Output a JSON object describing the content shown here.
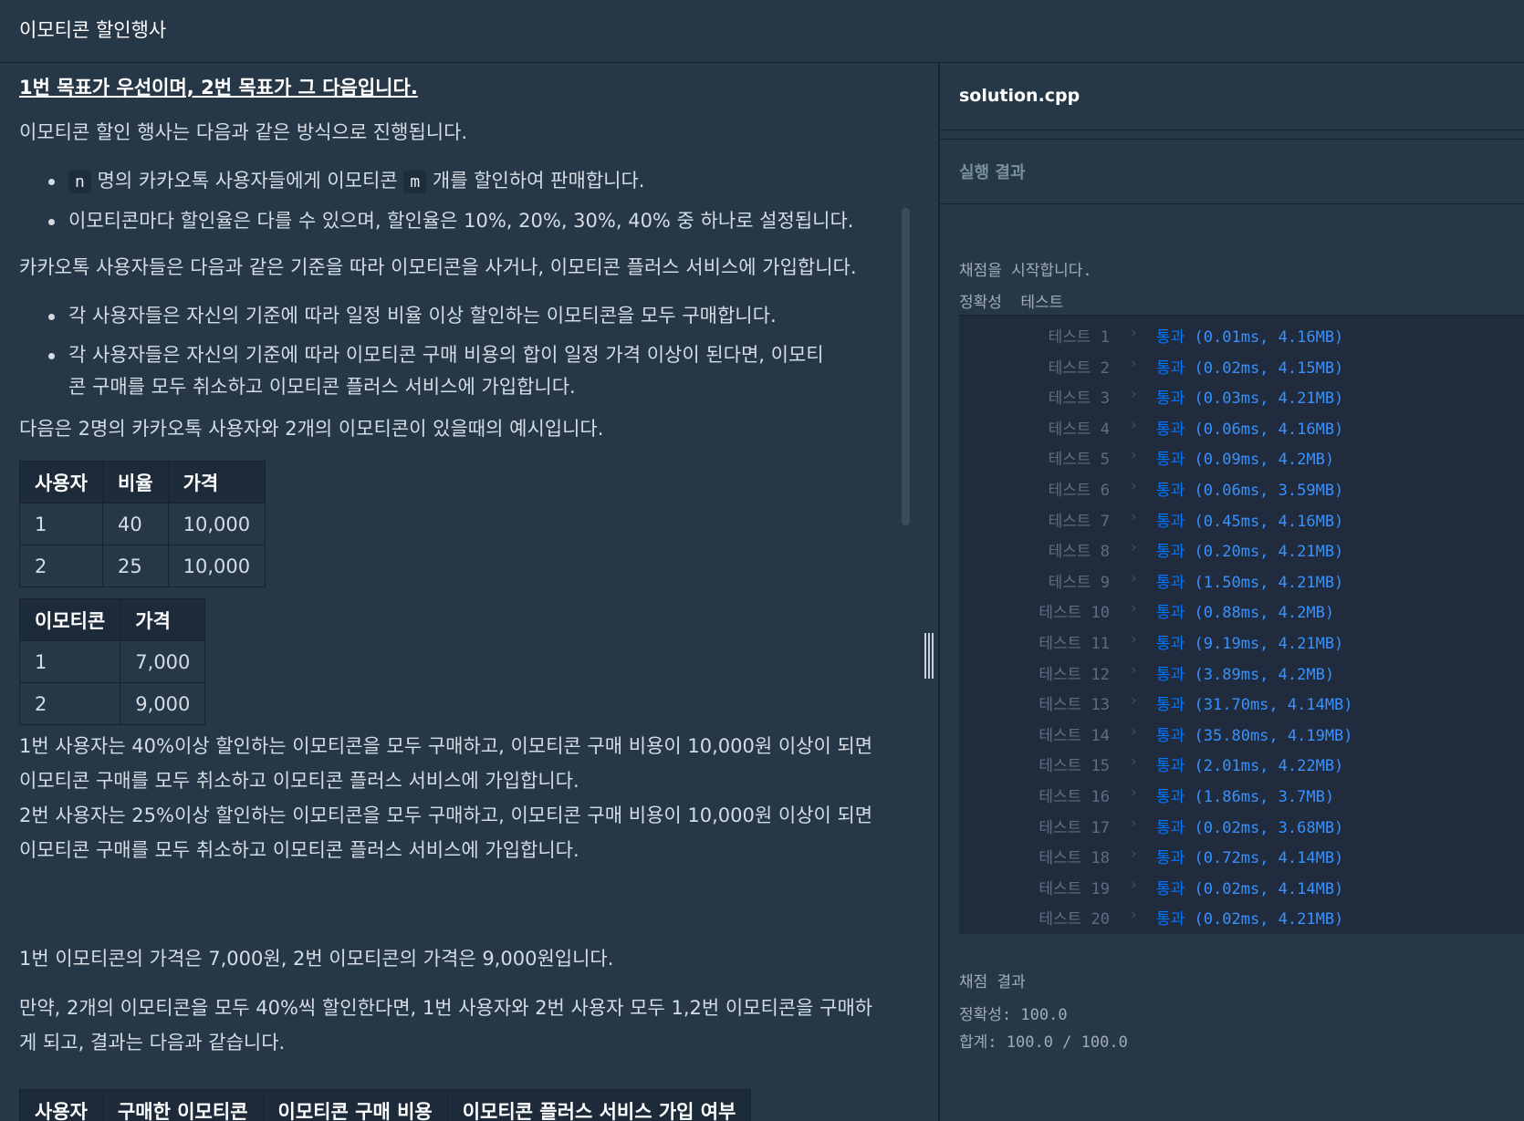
{
  "header": {
    "title": "이모티콘 할인행사"
  },
  "problem": {
    "headline": "1번 목표가 우선이며, 2번 목표가 그 다음입니다.",
    "intro": "이모티콘 할인 행사는 다음과 같은 방식으로 진행됩니다.",
    "bullets1": {
      "b1": {
        "code_n": "n",
        "text1": "명의 카카오톡 사용자들에게 이모티콘",
        "code_m": "m",
        "text2": "개를 할인하여 판매합니다."
      },
      "b2": "이모티콘마다 할인율은 다를 수 있으며, 할인율은 10%, 20%, 30%, 40% 중 하나로 설정됩니다."
    },
    "para2": "카카오톡 사용자들은 다음과 같은 기준을 따라 이모티콘을 사거나, 이모티콘 플러스 서비스에 가입합니다.",
    "bullets2": [
      "각 사용자들은 자신의 기준에 따라 일정 비율 이상 할인하는 이모티콘을 모두 구매합니다.",
      "각 사용자들은 자신의 기준에 따라 이모티콘 구매 비용의 합이 일정 가격 이상이 된다면, 이모티콘 구매를 모두 취소하고 이모티콘 플러스 서비스에 가입합니다."
    ],
    "para3": "다음은 2명의 카카오톡 사용자와 2개의 이모티콘이 있을때의 예시입니다.",
    "table_users": {
      "headers": [
        "사용자",
        "비율",
        "가격"
      ],
      "rows": [
        [
          "1",
          "40",
          "10,000"
        ],
        [
          "2",
          "25",
          "10,000"
        ]
      ]
    },
    "table_emoticons": {
      "headers": [
        "이모티콘",
        "가격"
      ],
      "rows": [
        [
          "1",
          "7,000"
        ],
        [
          "2",
          "9,000"
        ]
      ]
    },
    "para4_l1": "1번 사용자는 40%이상 할인하는 이모티콘을 모두 구매하고, 이모티콘 구매 비용이 10,000원 이상이 되면",
    "para4_l2": "이모티콘 구매를 모두 취소하고 이모티콘 플러스 서비스에 가입합니다.",
    "para4_l3": "2번 사용자는 25%이상 할인하는 이모티콘을 모두 구매하고, 이모티콘 구매 비용이 10,000원 이상이 되면",
    "para4_l4": "이모티콘 구매를 모두 취소하고 이모티콘 플러스 서비스에 가입합니다.",
    "para5": "1번 이모티콘의 가격은 7,000원, 2번 이모티콘의 가격은 9,000원입니다.",
    "para6_l1": "만약, 2개의 이모티콘을 모두 40%씩 할인한다면, 1번 사용자와 2번 사용자 모두 1,2번 이모티콘을 구매하",
    "para6_l2": "게 되고, 결과는 다음과 같습니다.",
    "table_results_headers": [
      "사용자",
      "구매한 이모티콘",
      "이모티콘 구매 비용",
      "이모티콘 플러스 서비스 가입 여부"
    ]
  },
  "editor": {
    "filename": "solution.cpp"
  },
  "run": {
    "header": "실행 결과",
    "start": "채점을 시작합니다.",
    "section": "정확성  테스트",
    "tests": [
      {
        "label": "테스트 1",
        "status": "통과",
        "detail": "(0.01ms, 4.16MB)"
      },
      {
        "label": "테스트 2",
        "status": "통과",
        "detail": "(0.02ms, 4.15MB)"
      },
      {
        "label": "테스트 3",
        "status": "통과",
        "detail": "(0.03ms, 4.21MB)"
      },
      {
        "label": "테스트 4",
        "status": "통과",
        "detail": "(0.06ms, 4.16MB)"
      },
      {
        "label": "테스트 5",
        "status": "통과",
        "detail": "(0.09ms, 4.2MB)"
      },
      {
        "label": "테스트 6",
        "status": "통과",
        "detail": "(0.06ms, 3.59MB)"
      },
      {
        "label": "테스트 7",
        "status": "통과",
        "detail": "(0.45ms, 4.16MB)"
      },
      {
        "label": "테스트 8",
        "status": "통과",
        "detail": "(0.20ms, 4.21MB)"
      },
      {
        "label": "테스트 9",
        "status": "통과",
        "detail": "(1.50ms, 4.21MB)"
      },
      {
        "label": "테스트 10",
        "status": "통과",
        "detail": "(0.88ms, 4.2MB)"
      },
      {
        "label": "테스트 11",
        "status": "통과",
        "detail": "(9.19ms, 4.21MB)"
      },
      {
        "label": "테스트 12",
        "status": "통과",
        "detail": "(3.89ms, 4.2MB)"
      },
      {
        "label": "테스트 13",
        "status": "통과",
        "detail": "(31.70ms, 4.14MB)"
      },
      {
        "label": "테스트 14",
        "status": "통과",
        "detail": "(35.80ms, 4.19MB)"
      },
      {
        "label": "테스트 15",
        "status": "통과",
        "detail": "(2.01ms, 4.22MB)"
      },
      {
        "label": "테스트 16",
        "status": "통과",
        "detail": "(1.86ms, 3.7MB)"
      },
      {
        "label": "테스트 17",
        "status": "통과",
        "detail": "(0.02ms, 3.68MB)"
      },
      {
        "label": "테스트 18",
        "status": "통과",
        "detail": "(0.72ms, 4.14MB)"
      },
      {
        "label": "테스트 19",
        "status": "통과",
        "detail": "(0.02ms, 4.14MB)"
      },
      {
        "label": "테스트 20",
        "status": "통과",
        "detail": "(0.02ms, 4.21MB)"
      }
    ],
    "summary_title": "채점 결과",
    "accuracy": "정확성: 100.0",
    "total": "합계: 100.0 / 100.0"
  }
}
